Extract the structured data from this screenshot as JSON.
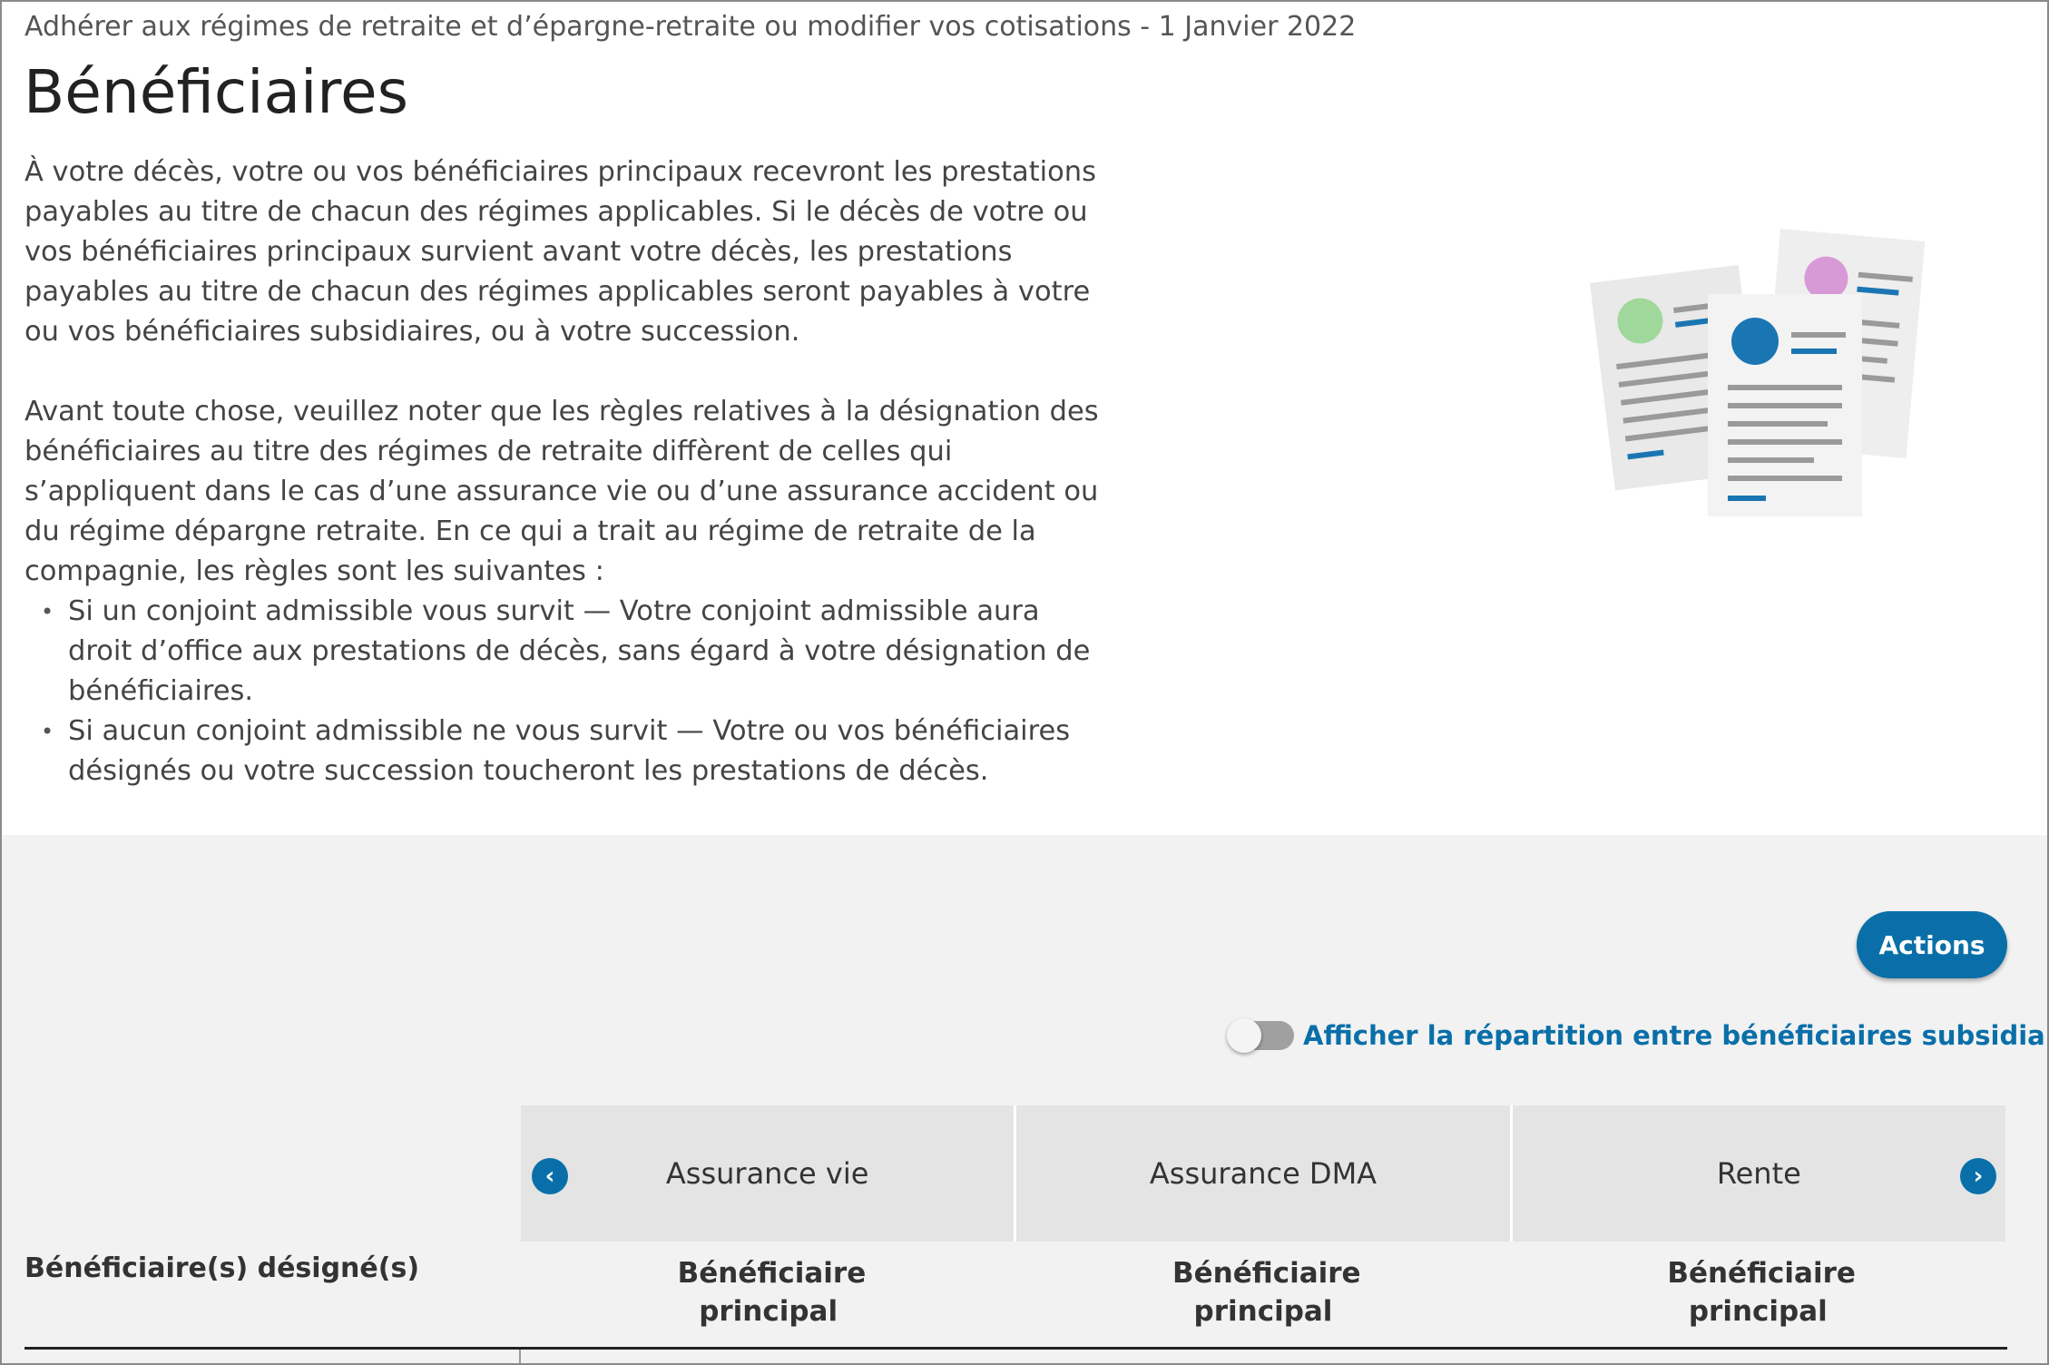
{
  "header": {
    "breadcrumb": "Adhérer aux régimes de retraite et d’épargne-retraite ou modifier vos cotisations - 1 Janvier 2022",
    "title": "Bénéficiaires"
  },
  "intro": {
    "paragraph1": "À votre décès, votre ou vos bénéficiaires principaux recevront les prestations payables au titre de chacun des régimes applicables. Si le décès de votre ou vos bénéficiaires principaux survient avant votre décès, les prestations payables au titre de chacun des régimes applicables seront payables à votre ou vos bénéficiaires subsidiaires, ou à votre succession.",
    "paragraph2": "Avant toute chose, veuillez noter que les règles relatives à la désignation des bénéficiaires au titre des régimes de retraite diffèrent de celles qui s’appliquent dans le cas d’une assurance vie ou d’une assurance accident ou du régime dépargne retraite. En ce qui a trait au régime de retraite de la compagnie, les règles sont les suivantes :",
    "bullets": [
      "Si un conjoint admissible vous survit — Votre conjoint admissible aura droit d’office aux prestations de décès, sans égard à votre désignation de bénéficiaires.",
      "Si aucun conjoint admissible ne vous survit — Votre ou vos bénéficiaires désignés ou votre succession toucheront les prestations de décès."
    ],
    "illustration_icon": "beneficiary-documents-illustration"
  },
  "controls": {
    "actions_label": "Actions",
    "toggle_label": "Afficher la répartition entre bénéficiaires subsidiaires",
    "toggle_on": false,
    "help_glyph": "?"
  },
  "table": {
    "row_label": "Bénéficiaire(s) désigné(s)",
    "prev_glyph": "‹",
    "next_glyph": "›",
    "plans": [
      {
        "name": "Assurance vie",
        "beneficiary_type": "Bénéficiaire principal"
      },
      {
        "name": "Assurance DMA",
        "beneficiary_type": "Bénéficiaire principal"
      },
      {
        "name": "Rente",
        "beneficiary_type": "Bénéficiaire principal"
      }
    ]
  },
  "colors": {
    "accent": "#0a6fa8",
    "help_red": "#c8102e",
    "panel_bg": "#f2f2f2",
    "header_cell_bg": "#e4e4e4"
  }
}
